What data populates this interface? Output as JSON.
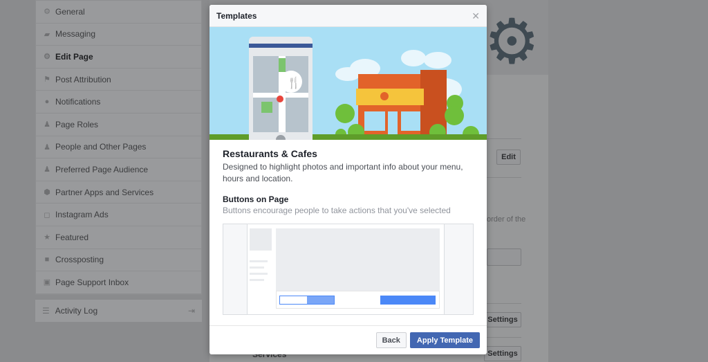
{
  "sidebar": {
    "items": [
      {
        "label": "General",
        "icon": "gear-icon"
      },
      {
        "label": "Messaging",
        "icon": "messaging-icon"
      },
      {
        "label": "Edit Page",
        "icon": "gear-icon",
        "active": true
      },
      {
        "label": "Post Attribution",
        "icon": "flag-icon"
      },
      {
        "label": "Notifications",
        "icon": "globe-icon"
      },
      {
        "label": "Page Roles",
        "icon": "person-icon"
      },
      {
        "label": "People and Other Pages",
        "icon": "person-star-icon"
      },
      {
        "label": "Preferred Page Audience",
        "icon": "person-star-icon"
      },
      {
        "label": "Partner Apps and Services",
        "icon": "box-icon"
      },
      {
        "label": "Instagram Ads",
        "icon": "instagram-icon"
      },
      {
        "label": "Featured",
        "icon": "star-icon"
      },
      {
        "label": "Crossposting",
        "icon": "video-icon"
      },
      {
        "label": "Page Support Inbox",
        "icon": "facebook-icon"
      }
    ],
    "activity_log": "Activity Log"
  },
  "background": {
    "edit": "Edit",
    "settings1": "Settings",
    "settings2": "Settings",
    "text_fragment": "order of the",
    "services": "Services"
  },
  "modal": {
    "title": "Templates",
    "template_name": "Restaurants & Cafes",
    "template_desc": "Designed to highlight photos and important info about your menu, hours and location.",
    "section_title": "Buttons on Page",
    "section_desc": "Buttons encourage people to take actions that you've selected",
    "back": "Back",
    "apply": "Apply Template"
  },
  "colors": {
    "primary": "#4267b2",
    "sky": "#a9dff5",
    "grass": "#5f9d2a",
    "building": "#e2632a"
  }
}
